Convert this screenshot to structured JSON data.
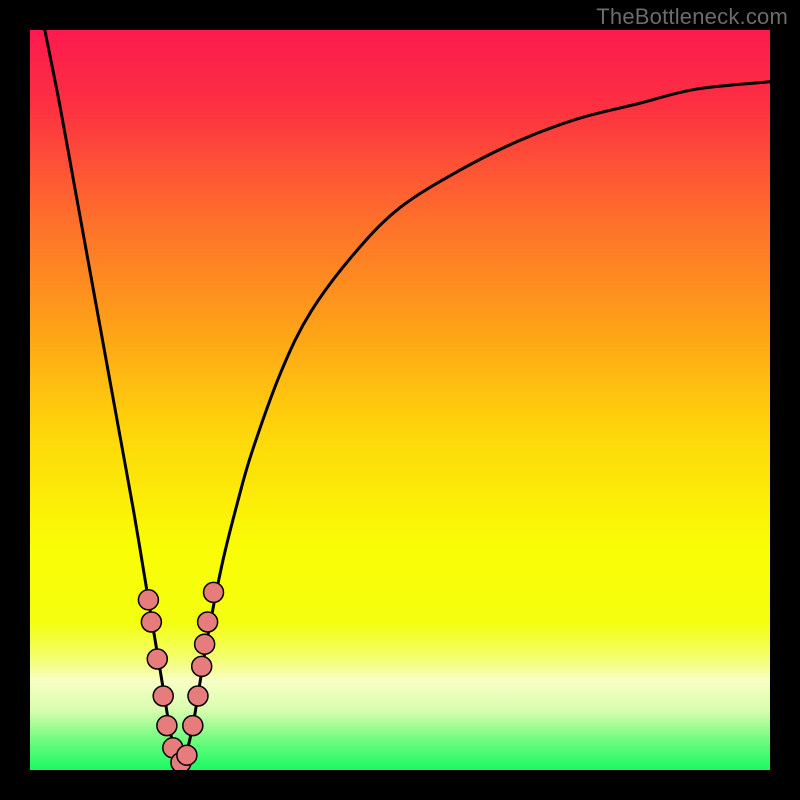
{
  "watermark": "TheBottleneck.com",
  "colors": {
    "frame": "#000000",
    "gradient_stops": [
      {
        "offset": 0,
        "color": "#fc1a4f"
      },
      {
        "offset": 0.1,
        "color": "#fd2f42"
      },
      {
        "offset": 0.25,
        "color": "#fe6d2d"
      },
      {
        "offset": 0.4,
        "color": "#fea018"
      },
      {
        "offset": 0.55,
        "color": "#fed80a"
      },
      {
        "offset": 0.7,
        "color": "#fafd05"
      },
      {
        "offset": 0.8,
        "color": "#f4fe0f"
      },
      {
        "offset": 0.85,
        "color": "#f4fe72"
      },
      {
        "offset": 0.88,
        "color": "#f8fec6"
      },
      {
        "offset": 0.92,
        "color": "#d7fdae"
      },
      {
        "offset": 0.96,
        "color": "#6efb7e"
      },
      {
        "offset": 1.0,
        "color": "#1af965"
      }
    ],
    "curve_stroke": "#000000",
    "marker_fill": "#e77c7c",
    "marker_stroke": "#000000"
  },
  "chart_data": {
    "type": "line",
    "title": "",
    "xlabel": "",
    "ylabel": "",
    "xlim": [
      0,
      100
    ],
    "ylim": [
      0,
      100
    ],
    "x_optimum": 20,
    "series": [
      {
        "name": "bottleneck-curve",
        "x": [
          0,
          2,
          4,
          6,
          8,
          10,
          12,
          14,
          16,
          17,
          18,
          19,
          20,
          21,
          22,
          23,
          24,
          26,
          28,
          30,
          34,
          38,
          44,
          50,
          58,
          66,
          74,
          82,
          90,
          100
        ],
        "values": [
          110,
          100,
          90,
          79,
          68,
          57,
          46,
          35,
          23,
          17,
          11,
          5,
          1,
          2,
          6,
          12,
          18,
          28,
          36,
          43,
          54,
          62,
          70,
          76,
          81,
          85,
          88,
          90,
          92,
          93
        ]
      }
    ],
    "markers": [
      {
        "x": 16.0,
        "y": 23
      },
      {
        "x": 16.4,
        "y": 20
      },
      {
        "x": 17.2,
        "y": 15
      },
      {
        "x": 18.0,
        "y": 10
      },
      {
        "x": 18.5,
        "y": 6
      },
      {
        "x": 19.3,
        "y": 3
      },
      {
        "x": 20.4,
        "y": 1
      },
      {
        "x": 21.2,
        "y": 2
      },
      {
        "x": 22.0,
        "y": 6
      },
      {
        "x": 22.7,
        "y": 10
      },
      {
        "x": 23.2,
        "y": 14
      },
      {
        "x": 23.6,
        "y": 17
      },
      {
        "x": 24.0,
        "y": 20
      },
      {
        "x": 24.8,
        "y": 24
      }
    ]
  }
}
